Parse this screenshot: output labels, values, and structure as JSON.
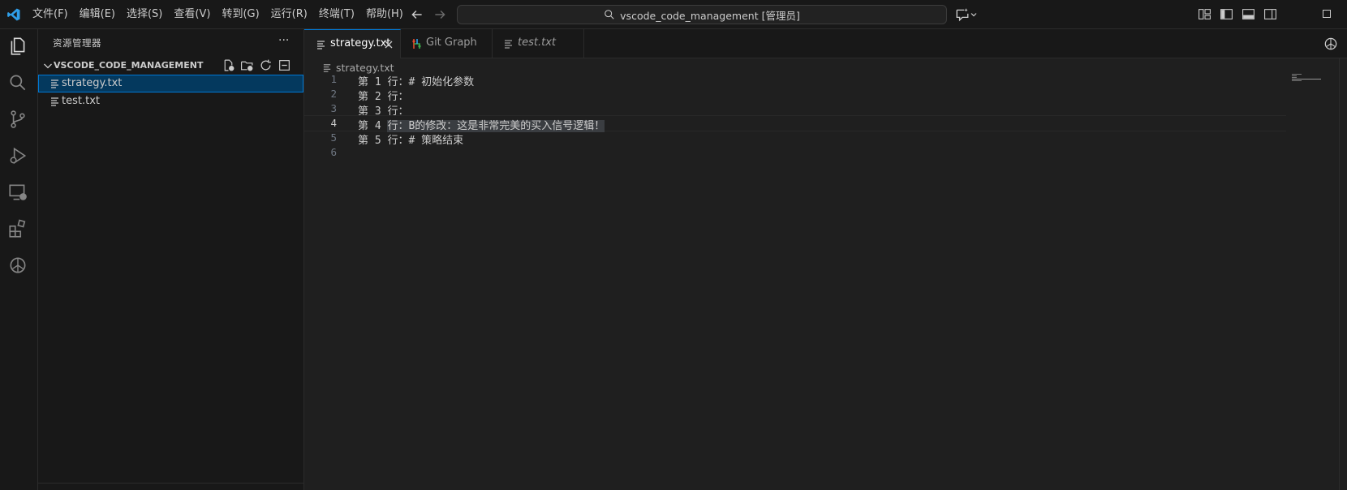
{
  "menubar": {
    "items": [
      "文件(F)",
      "编辑(E)",
      "选择(S)",
      "查看(V)",
      "转到(G)",
      "运行(R)",
      "终端(T)",
      "帮助(H)"
    ]
  },
  "command_center": {
    "text": "vscode_code_management [管理员]"
  },
  "sidebar": {
    "title": "资源管理器",
    "more": "···",
    "folder": "VSCODE_CODE_MANAGEMENT",
    "files": [
      {
        "name": "strategy.txt",
        "selected": true
      },
      {
        "name": "test.txt",
        "selected": false
      }
    ]
  },
  "tabs": [
    {
      "label": "strategy.txt",
      "active": true,
      "icon": "file-lines-icon"
    },
    {
      "label": "Git Graph",
      "active": false,
      "icon": "git-graph-icon"
    },
    {
      "label": "test.txt",
      "active": false,
      "icon": "file-lines-icon",
      "italic": true
    }
  ],
  "breadcrumb": {
    "file": "strategy.txt"
  },
  "editor": {
    "lines": [
      {
        "num": "1",
        "text": "第 1 行：# 初始化参数"
      },
      {
        "num": "2",
        "text": "第 2 行："
      },
      {
        "num": "3",
        "text": "第 3 行："
      },
      {
        "num": "4",
        "prefix": "第 4 ",
        "selected": "行：B的修改：这是非常完美的买入信号逻辑！",
        "current": true
      },
      {
        "num": "5",
        "text": "第 5 行：# 策略结束"
      },
      {
        "num": "6",
        "text": ""
      }
    ]
  },
  "colors": {
    "accent": "#0078d4",
    "background": "#1f1f1f",
    "sidebar_bg": "#181818",
    "selection": "#04395e"
  }
}
